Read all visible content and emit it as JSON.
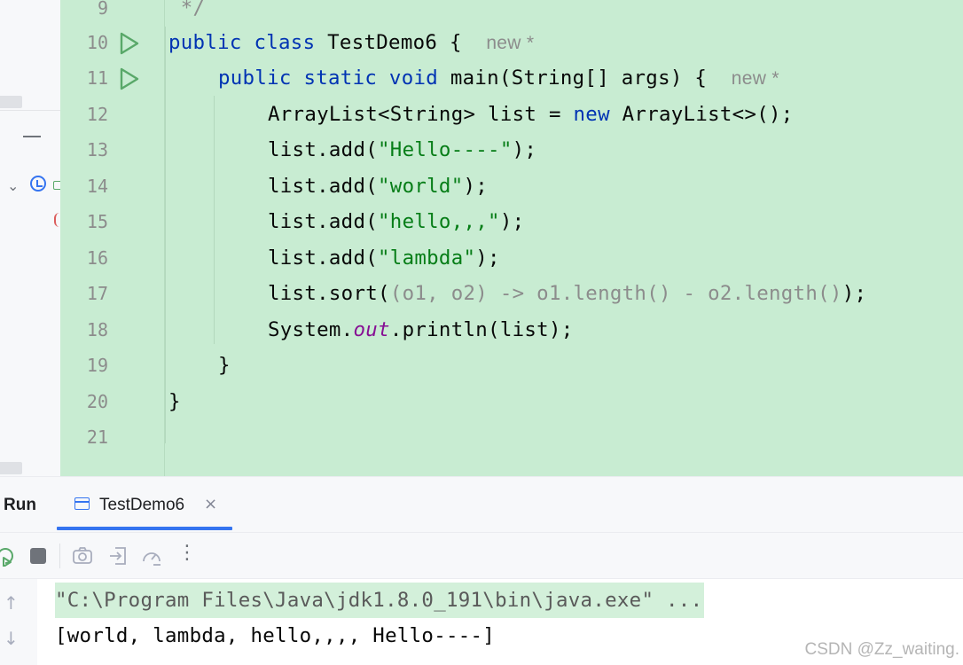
{
  "editor": {
    "hint_label": "new *",
    "lines": [
      {
        "number": "9"
      },
      {
        "number": "10"
      },
      {
        "number": "11"
      },
      {
        "number": "12"
      },
      {
        "number": "13"
      },
      {
        "number": "14"
      },
      {
        "number": "15"
      },
      {
        "number": "16"
      },
      {
        "number": "17"
      },
      {
        "number": "18"
      },
      {
        "number": "19"
      },
      {
        "number": "20"
      },
      {
        "number": "21"
      }
    ],
    "code": {
      "l9": " */",
      "l10_kw": "public class",
      "l10_rest": " TestDemo6 {",
      "l11_kw": "public static void",
      "l11_rest": " main(String[] args) {",
      "l12_a": "ArrayList<String> list = ",
      "l12_kw": "new",
      "l12_b": " ArrayList<>();",
      "l13_a": "list.add(",
      "l13_str": "\"Hello----\"",
      "l13_b": ");",
      "l14_a": "list.add(",
      "l14_str": "\"world\"",
      "l14_b": ");",
      "l15_a": "list.add(",
      "l15_str": "\"hello,,,\"",
      "l15_b": ");",
      "l16_a": "list.add(",
      "l16_str": "\"lambda\"",
      "l16_b": ");",
      "l17_a": "list.sort(",
      "l17_lam": "(o1, o2) -> o1.length() - o2.length()",
      "l17_b": ");",
      "l18_a": "System.",
      "l18_fld": "out",
      "l18_b": ".println(list);",
      "l19": "}",
      "l20": "}"
    }
  },
  "run_panel": {
    "title": "Run",
    "tab_label": "TestDemo6",
    "tab_close": "×",
    "toolbar_more": "⋮",
    "console": {
      "command": "\"C:\\Program Files\\Java\\jdk1.8.0_191\\bin\\java.exe\" ...",
      "output": "[world, lambda, hello,,,, Hello----]"
    },
    "scroll_up": "↑",
    "scroll_down": "↓"
  },
  "watermark": "CSDN @Zz_waiting.",
  "colors": {
    "editor_bg": "#c8ecd2",
    "keyword": "#0033b3",
    "string": "#067d17",
    "field": "#871094",
    "accent": "#3574f0",
    "run_green": "#59a869"
  }
}
